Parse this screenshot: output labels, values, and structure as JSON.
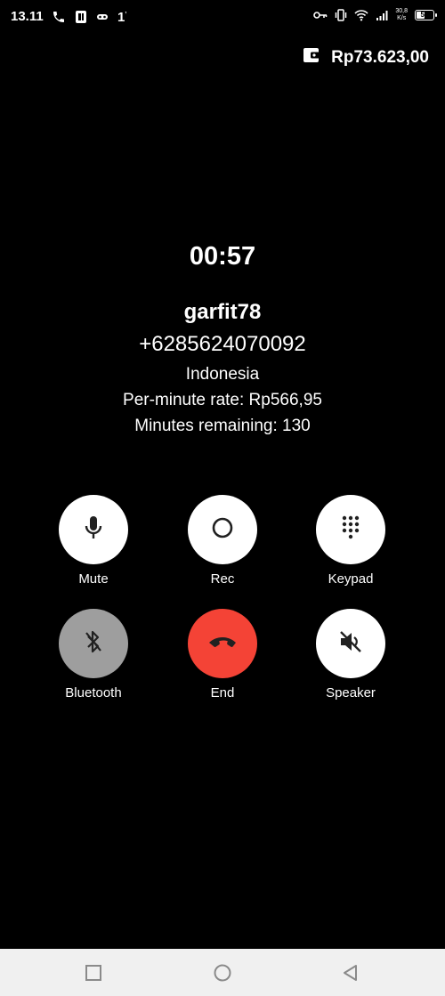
{
  "status_bar": {
    "time": "13.11",
    "left_icons": [
      "phone-icon",
      "sim-icon",
      "infinity-icon",
      "one-notify-icon"
    ],
    "one_text": "1",
    "right_icons": [
      "key-icon",
      "vibrate-icon",
      "wifi-icon",
      "signal-icon"
    ],
    "net_speed_value": "30,8",
    "net_speed_unit": "K/s",
    "battery": "57"
  },
  "balance": {
    "icon": "wallet-icon",
    "amount": "Rp73.623,00"
  },
  "call": {
    "timer": "00:57",
    "name": "garfit78",
    "number": "+6285624070092",
    "country": "Indonesia",
    "rate": "Per-minute rate: Rp566,95",
    "minutes": "Minutes remaining: 130"
  },
  "controls": {
    "mute": {
      "label": "Mute",
      "icon": "microphone-icon"
    },
    "rec": {
      "label": "Rec",
      "icon": "record-icon"
    },
    "keypad": {
      "label": "Keypad",
      "icon": "dialpad-icon"
    },
    "bluetooth": {
      "label": "Bluetooth",
      "icon": "bluetooth-disabled-icon"
    },
    "end": {
      "label": "End",
      "icon": "hang-up-icon"
    },
    "speaker": {
      "label": "Speaker",
      "icon": "speaker-off-icon"
    }
  },
  "nav": {
    "recents": "square-icon",
    "home": "circle-icon",
    "back": "triangle-back-icon"
  },
  "colors": {
    "background": "#000000",
    "end_button": "#f44336",
    "bluetooth_button": "#9e9e9e",
    "button": "#ffffff",
    "nav_bar": "#f0f0f0"
  }
}
